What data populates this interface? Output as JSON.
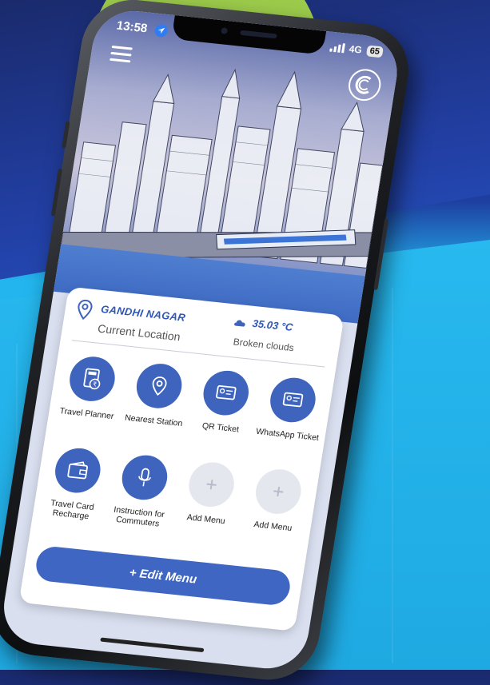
{
  "status_bar": {
    "time": "13:58",
    "network": "4G",
    "battery": "65"
  },
  "location": {
    "name": "GANDHI NAGAR",
    "caption": "Current Location"
  },
  "weather": {
    "temperature": "35.03 °C",
    "description": "Broken clouds"
  },
  "menu": {
    "items": [
      {
        "label": "Travel Planner",
        "icon": "calculator-rupee-icon"
      },
      {
        "label": "Nearest Station",
        "icon": "location-pin-icon"
      },
      {
        "label": "QR Ticket",
        "icon": "ticket-card-icon"
      },
      {
        "label": "WhatsApp Ticket",
        "icon": "ticket-card-icon"
      },
      {
        "label": "Travel Card Recharge",
        "icon": "wallet-icon"
      },
      {
        "label": "Instruction for Commuters",
        "icon": "microphone-icon"
      },
      {
        "label": "Add Menu",
        "icon": "plus-icon"
      },
      {
        "label": "Add Menu",
        "icon": "plus-icon"
      }
    ],
    "edit_label": "+ Edit Menu"
  },
  "colors": {
    "accent": "#3e64be",
    "location_text": "#2e57b8",
    "background_green": "#9ccb4b",
    "background_blue": "#27b9ef"
  }
}
